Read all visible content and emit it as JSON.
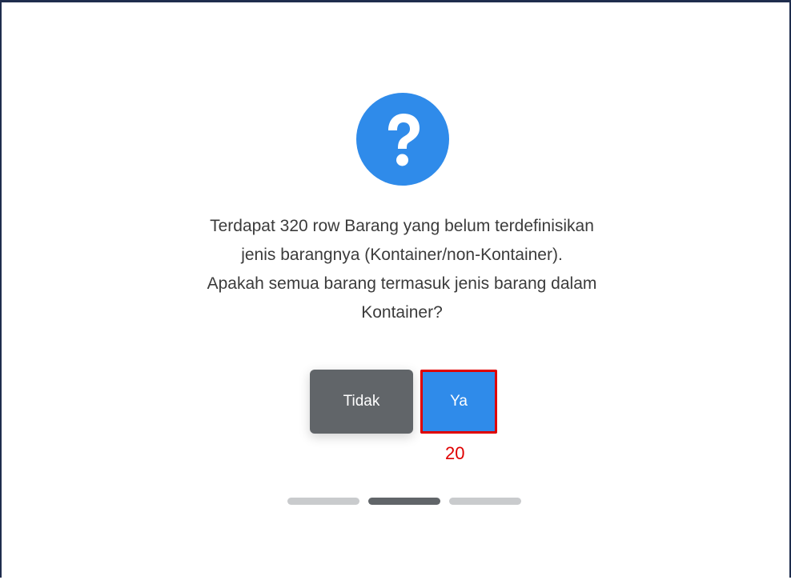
{
  "dialog": {
    "icon": "question-circle-icon",
    "icon_glyph": "?",
    "icon_color": "#2f8bea",
    "message_lines": [
      "Terdapat 320 row Barang yang belum terdefinisikan",
      "jenis barangnya (Kontainer/non-Kontainer).",
      "Apakah semua barang termasuk jenis barang dalam",
      "Kontainer?"
    ],
    "cancel_label": "Tidak",
    "confirm_label": "Ya",
    "cancel_color": "#616569",
    "confirm_color": "#2f8bea"
  },
  "annotation": {
    "marker_label": "20",
    "highlight_color": "#e00000"
  },
  "progress_steps": {
    "count": 3,
    "active_index": 1
  }
}
